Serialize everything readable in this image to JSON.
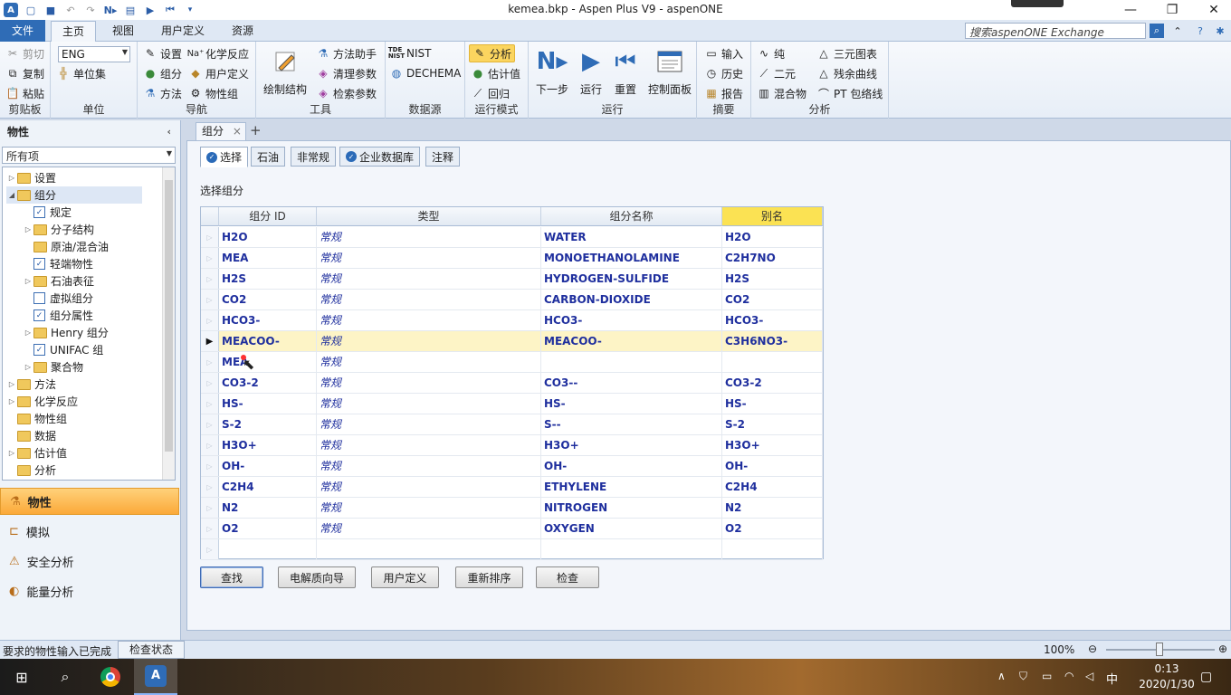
{
  "window": {
    "title": "kemea.bkp - Aspen Plus V9 - aspenONE",
    "minimize": "—",
    "restore": "❐",
    "close": "✕"
  },
  "ribbon_tabs": [
    "文件",
    "主页",
    "视图",
    "用户定义",
    "资源"
  ],
  "search": {
    "placeholder": "搜索aspenONE Exchange"
  },
  "ribbon": {
    "clipboard": {
      "label": "剪贴板",
      "cut": "剪切",
      "copy": "复制",
      "paste": "粘贴"
    },
    "units": {
      "label": "单位",
      "value": "ENG",
      "unit_sets": "单位集"
    },
    "navigate": {
      "label": "导航",
      "setup": "设置",
      "components": "组分",
      "methods": "方法",
      "chem_reactions": "化学反应",
      "user_defined": "用户定义",
      "prop_sets": "物性组"
    },
    "tools": {
      "label": "工具",
      "draw_structure": "绘制结构",
      "methods_assistant": "方法助手",
      "clean_params": "清理参数",
      "retrieve_params": "检索参数"
    },
    "data_source": {
      "label": "数据源",
      "nist": "NIST",
      "dechema": "DECHEMA"
    },
    "run_mode": {
      "label": "运行模式",
      "analysis": "分析",
      "estimation": "估计值",
      "regression": "回归"
    },
    "run": {
      "label": "运行",
      "next": "下一步",
      "run": "运行",
      "reset": "重置",
      "control_panel": "控制面板"
    },
    "summary": {
      "label": "摘要",
      "input": "输入",
      "history": "历史",
      "report": "报告"
    },
    "analysis": {
      "label": "分析",
      "pure": "纯",
      "binary": "二元",
      "mixture": "混合物",
      "ternary": "三元图表",
      "residue": "残余曲线",
      "pt_envelope": "PT 包络线"
    }
  },
  "nav": {
    "title": "物性",
    "filter": "所有项",
    "tree": [
      {
        "label": "设置",
        "level": 0,
        "icon": "folder",
        "expander": "▷"
      },
      {
        "label": "组分",
        "level": 0,
        "icon": "folder",
        "expander": "◢",
        "selected": true
      },
      {
        "label": "规定",
        "level": 1,
        "icon": "check",
        "expander": ""
      },
      {
        "label": "分子结构",
        "level": 1,
        "icon": "folder",
        "expander": "▷"
      },
      {
        "label": "原油/混合油",
        "level": 1,
        "icon": "folder",
        "expander": ""
      },
      {
        "label": "轻端物性",
        "level": 1,
        "icon": "check",
        "expander": ""
      },
      {
        "label": "石油表征",
        "level": 1,
        "icon": "folder",
        "expander": "▷"
      },
      {
        "label": "虚拟组分",
        "level": 1,
        "icon": "empty",
        "expander": ""
      },
      {
        "label": "组分属性",
        "level": 1,
        "icon": "check",
        "expander": ""
      },
      {
        "label": "Henry 组分",
        "level": 1,
        "icon": "folder",
        "expander": "▷"
      },
      {
        "label": "UNIFAC 组",
        "level": 1,
        "icon": "check",
        "expander": ""
      },
      {
        "label": "聚合物",
        "level": 1,
        "icon": "folder",
        "expander": "▷"
      },
      {
        "label": "方法",
        "level": 0,
        "icon": "folder",
        "expander": "▷"
      },
      {
        "label": "化学反应",
        "level": 0,
        "icon": "folder",
        "expander": "▷"
      },
      {
        "label": "物性组",
        "level": 0,
        "icon": "folder",
        "expander": ""
      },
      {
        "label": "数据",
        "level": 0,
        "icon": "folder",
        "expander": ""
      },
      {
        "label": "估计值",
        "level": 0,
        "icon": "folder",
        "expander": "▷"
      },
      {
        "label": "分析",
        "level": 0,
        "icon": "folder",
        "expander": ""
      }
    ],
    "sections": [
      "物性",
      "模拟",
      "安全分析",
      "能量分析"
    ]
  },
  "doc_tab": "组分",
  "sub_tabs": [
    "选择",
    "石油",
    "非常规",
    "企业数据库",
    "注释"
  ],
  "section_label": "选择组分",
  "grid": {
    "headers": [
      "组分 ID",
      "类型",
      "组分名称",
      "别名"
    ],
    "rows": [
      {
        "id": "H2O",
        "type": "常规",
        "name": "WATER",
        "alias": "H2O"
      },
      {
        "id": "MEA",
        "type": "常规",
        "name": "MONOETHANOLAMINE",
        "alias": "C2H7NO"
      },
      {
        "id": "H2S",
        "type": "常规",
        "name": "HYDROGEN-SULFIDE",
        "alias": "H2S"
      },
      {
        "id": "CO2",
        "type": "常规",
        "name": "CARBON-DIOXIDE",
        "alias": "CO2"
      },
      {
        "id": "HCO3-",
        "type": "常规",
        "name": "HCO3-",
        "alias": "HCO3-"
      },
      {
        "id": "MEACOO-",
        "type": "常规",
        "name": "MEACOO-",
        "alias": "C3H6NO3-",
        "selected": true
      },
      {
        "id": "MEA",
        "type": "常规",
        "name": "",
        "alias": ""
      },
      {
        "id": "CO3-2",
        "type": "常规",
        "name": "CO3--",
        "alias": "CO3-2"
      },
      {
        "id": "HS-",
        "type": "常规",
        "name": "HS-",
        "alias": "HS-"
      },
      {
        "id": "S-2",
        "type": "常规",
        "name": "S--",
        "alias": "S-2"
      },
      {
        "id": "H3O+",
        "type": "常规",
        "name": "H3O+",
        "alias": "H3O+"
      },
      {
        "id": "OH-",
        "type": "常规",
        "name": "OH-",
        "alias": "OH-"
      },
      {
        "id": "C2H4",
        "type": "常规",
        "name": "ETHYLENE",
        "alias": "C2H4"
      },
      {
        "id": "N2",
        "type": "常规",
        "name": "NITROGEN",
        "alias": "N2"
      },
      {
        "id": "O2",
        "type": "常规",
        "name": "OXYGEN",
        "alias": "O2"
      },
      {
        "id": "",
        "type": "",
        "name": "",
        "alias": ""
      }
    ]
  },
  "buttons": [
    "查找",
    "电解质向导",
    "用户定义",
    "重新排序",
    "检查"
  ],
  "status": {
    "text": "要求的物性输入已完成",
    "check_status": "检查状态",
    "zoom": "100%"
  },
  "taskbar": {
    "time": "0:13",
    "date": "2020/1/30",
    "ime": "中"
  },
  "colors": {
    "accent": "#2f6cb6",
    "selected_row": "#fdf4c6",
    "alias_header": "#fbe253",
    "active_section": "#fba939",
    "component_text": "#1f2f9e"
  }
}
